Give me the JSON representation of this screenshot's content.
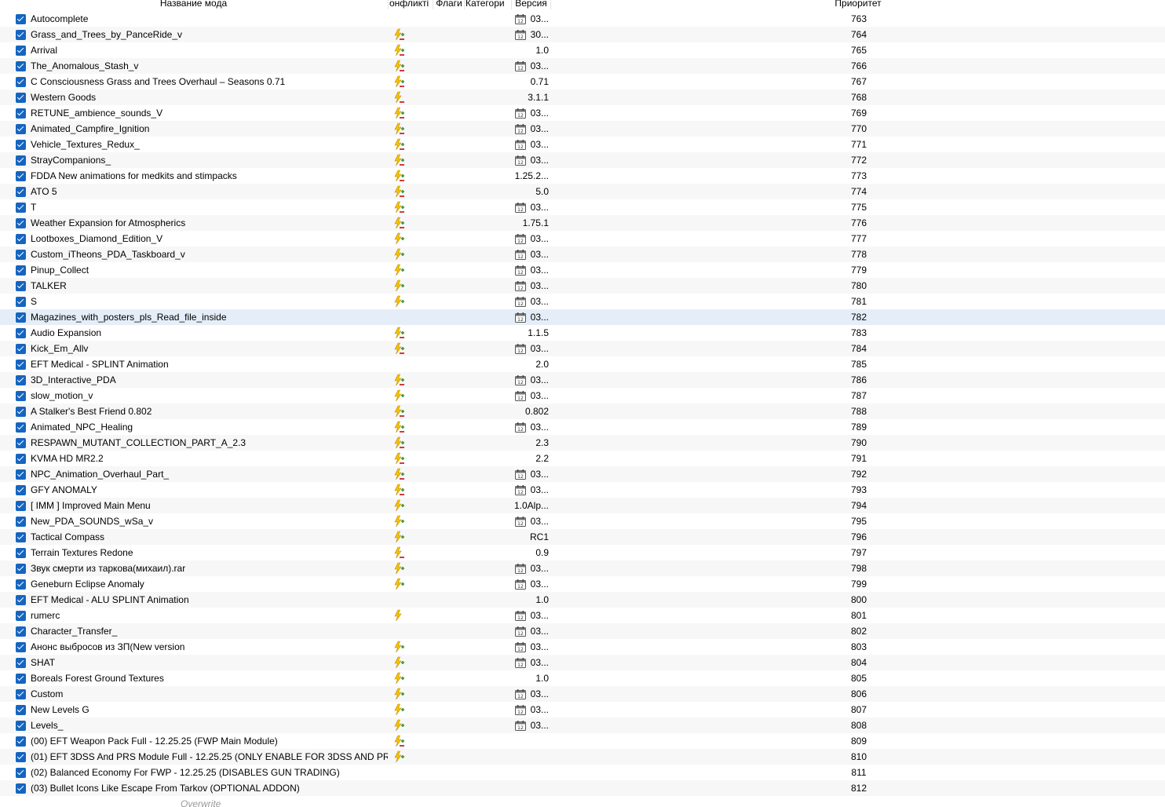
{
  "columns": {
    "name": "Название мода",
    "conflicts": "онфликті",
    "flags": "Флаги",
    "category": "Категори",
    "version": "Версия",
    "priority": "Приоритет"
  },
  "icons": {
    "conflict": "conflict-lightning-icon",
    "calendar": "calendar-icon",
    "checkbox": "checkbox-checked-icon"
  },
  "colors": {
    "checkbox": "#1565c0",
    "selected_row": "#e5eef8",
    "alt_row": "#f7f7f7",
    "lightning": "#f5c400",
    "plus": "#43a047",
    "minus": "#c62828"
  },
  "mods": [
    {
      "name": "Autocomplete",
      "conflict": "",
      "version": "03...",
      "cal": true,
      "priority": "763"
    },
    {
      "name": "Grass_and_Trees_by_PanceRide_v",
      "conflict": "both",
      "version": "30...",
      "cal": true,
      "priority": "764"
    },
    {
      "name": "Arrival",
      "conflict": "both",
      "version": "1.0",
      "cal": false,
      "priority": "765"
    },
    {
      "name": "The_Anomalous_Stash_v",
      "conflict": "both",
      "version": "03...",
      "cal": true,
      "priority": "766"
    },
    {
      "name": "C Consciousness Grass and Trees Overhaul – Seasons 0.71",
      "conflict": "both",
      "version": "0.71",
      "cal": false,
      "priority": "767"
    },
    {
      "name": "Western Goods",
      "conflict": "minus",
      "version": "3.1.1",
      "cal": false,
      "priority": "768"
    },
    {
      "name": "RETUNE_ambience_sounds_V",
      "conflict": "both",
      "version": "03...",
      "cal": true,
      "priority": "769"
    },
    {
      "name": "Animated_Campfire_Ignition",
      "conflict": "both",
      "version": "03...",
      "cal": true,
      "priority": "770"
    },
    {
      "name": "Vehicle_Textures_Redux_",
      "conflict": "both",
      "version": "03...",
      "cal": true,
      "priority": "771"
    },
    {
      "name": "StrayCompanions_",
      "conflict": "both",
      "version": "03...",
      "cal": true,
      "priority": "772"
    },
    {
      "name": "FDDA New animations for medkits and stimpacks",
      "conflict": "both",
      "version": "1.25.2...",
      "cal": false,
      "priority": "773"
    },
    {
      "name": "ATO 5",
      "conflict": "both",
      "version": "5.0",
      "cal": false,
      "priority": "774"
    },
    {
      "name": "T",
      "conflict": "both",
      "version": "03...",
      "cal": true,
      "priority": "775"
    },
    {
      "name": "Weather Expansion for Atmospherics",
      "conflict": "both",
      "version": "1.75.1",
      "cal": false,
      "priority": "776"
    },
    {
      "name": "Lootboxes_Diamond_Edition_V",
      "conflict": "plus",
      "version": "03...",
      "cal": true,
      "priority": "777"
    },
    {
      "name": "Custom_iTheons_PDA_Taskboard_v",
      "conflict": "plus",
      "version": "03...",
      "cal": true,
      "priority": "778"
    },
    {
      "name": "Pinup_Collect",
      "conflict": "plus",
      "version": "03...",
      "cal": true,
      "priority": "779"
    },
    {
      "name": "TALKER",
      "conflict": "plus",
      "version": "03...",
      "cal": true,
      "priority": "780"
    },
    {
      "name": "S",
      "conflict": "plus",
      "version": "03...",
      "cal": true,
      "priority": "781"
    },
    {
      "name": "Magazines_with_posters_pls_Read_file_inside",
      "conflict": "",
      "version": "03...",
      "cal": true,
      "priority": "782",
      "selected": true
    },
    {
      "name": "Audio Expansion",
      "conflict": "both",
      "version": "1.1.5",
      "cal": false,
      "priority": "783"
    },
    {
      "name": "Kick_Em_Allv",
      "conflict": "both",
      "version": "03...",
      "cal": true,
      "priority": "784"
    },
    {
      "name": "EFT Medical - SPLINT Animation",
      "conflict": "",
      "version": "2.0",
      "cal": false,
      "priority": "785"
    },
    {
      "name": "3D_Interactive_PDA",
      "conflict": "both",
      "version": "03...",
      "cal": true,
      "priority": "786"
    },
    {
      "name": "slow_motion_v",
      "conflict": "plus",
      "version": "03...",
      "cal": true,
      "priority": "787"
    },
    {
      "name": "A Stalker's Best Friend 0.802",
      "conflict": "both",
      "version": "0.802",
      "cal": false,
      "priority": "788"
    },
    {
      "name": "Animated_NPC_Healing",
      "conflict": "both",
      "version": "03...",
      "cal": true,
      "priority": "789"
    },
    {
      "name": "RESPAWN_MUTANT_COLLECTION_PART_A_2.3",
      "conflict": "both",
      "version": "2.3",
      "cal": false,
      "priority": "790"
    },
    {
      "name": "KVMA HD MR2.2",
      "conflict": "both",
      "version": "2.2",
      "cal": false,
      "priority": "791"
    },
    {
      "name": "NPC_Animation_Overhaul_Part_",
      "conflict": "both",
      "version": "03...",
      "cal": true,
      "priority": "792"
    },
    {
      "name": "GFY ANOMALY",
      "conflict": "both",
      "version": "03...",
      "cal": true,
      "priority": "793"
    },
    {
      "name": "[ IMM ] Improved Main Menu",
      "conflict": "plus",
      "version": "1.0Alp...",
      "cal": false,
      "priority": "794"
    },
    {
      "name": "New_PDA_SOUNDS_wSa_v",
      "conflict": "plus",
      "version": "03...",
      "cal": true,
      "priority": "795"
    },
    {
      "name": "Tactical Compass",
      "conflict": "plus",
      "version": "RC1",
      "cal": false,
      "priority": "796"
    },
    {
      "name": "Terrain Textures Redone",
      "conflict": "minus",
      "version": "0.9",
      "cal": false,
      "priority": "797"
    },
    {
      "name": "Звук смерти из таркова(михаил).rar",
      "conflict": "plus",
      "version": "03...",
      "cal": true,
      "priority": "798"
    },
    {
      "name": "Geneburn Eclipse Anomaly",
      "conflict": "plus",
      "version": "03...",
      "cal": true,
      "priority": "799"
    },
    {
      "name": "EFT Medical - ALU SPLINT Animation",
      "conflict": "",
      "version": "1.0",
      "cal": false,
      "priority": "800"
    },
    {
      "name": "rumerc",
      "conflict": "plain",
      "version": "03...",
      "cal": true,
      "priority": "801"
    },
    {
      "name": "Character_Transfer_",
      "conflict": "",
      "version": "03...",
      "cal": true,
      "priority": "802"
    },
    {
      "name": "Анонс выбросов из ЗП(New version",
      "conflict": "plus",
      "version": "03...",
      "cal": true,
      "priority": "803"
    },
    {
      "name": "SHAT",
      "conflict": "plus",
      "version": "03...",
      "cal": true,
      "priority": "804"
    },
    {
      "name": "Boreals Forest Ground Textures",
      "conflict": "plus",
      "version": "1.0",
      "cal": false,
      "priority": "805"
    },
    {
      "name": "Custom",
      "conflict": "plus",
      "version": "03...",
      "cal": true,
      "priority": "806"
    },
    {
      "name": "New Levels G",
      "conflict": "plus",
      "version": "03...",
      "cal": true,
      "priority": "807"
    },
    {
      "name": "Levels_",
      "conflict": "plus",
      "version": "03...",
      "cal": true,
      "priority": "808"
    },
    {
      "name": "(00) EFT Weapon Pack Full - 12.25.25 (FWP Main Module)",
      "conflict": "both",
      "version": "",
      "cal": false,
      "priority": "809"
    },
    {
      "name": "(01) EFT 3DSS And PRS Module Full - 12.25.25 (ONLY ENABLE FOR 3DSS AND PRS)",
      "conflict": "plus",
      "version": "",
      "cal": false,
      "priority": "810"
    },
    {
      "name": "(02) Balanced Economy For FWP - 12.25.25 (DISABLES GUN TRADING)",
      "conflict": "",
      "version": "",
      "cal": false,
      "priority": "811"
    },
    {
      "name": "(03) Bullet Icons Like Escape From Tarkov (OPTIONAL ADDON)",
      "conflict": "",
      "version": "",
      "cal": false,
      "priority": "812"
    }
  ],
  "footer": {
    "overwrite": "Overwrite"
  }
}
